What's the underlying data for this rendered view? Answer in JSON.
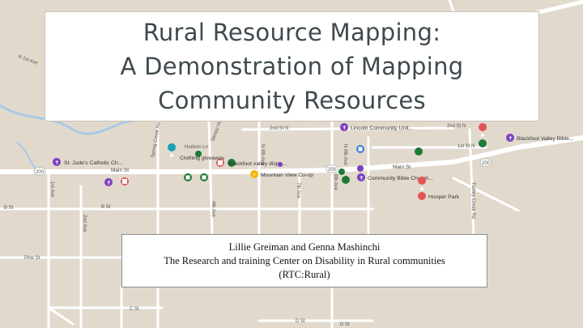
{
  "slide": {
    "title_lines": [
      "Rural Resource Mapping:",
      "A Demonstration of Mapping",
      "Community Resources"
    ],
    "authors": "Lillie Greiman and Genna Mashinchi",
    "organization": "The Research and training Center on Disability in Rural communities",
    "org_short": "(RTC:Rural)"
  },
  "map": {
    "streets": {
      "main_st_left": "Main St",
      "main_st_right": "Main St",
      "hudson_ln": "Hudson Ln",
      "second_st_n": "2nd St N",
      "second_st_n_right": "2nd St N",
      "first_st_n": "1st St N",
      "b_st": "B St",
      "b_st_2": "B St",
      "pine_st": "Pine St",
      "c_st": "C St",
      "d_st": "D St",
      "d_st_2": "D St",
      "first_ave_nw": "N 1st Ave",
      "first_ave": "1st Ave",
      "second_ave": "2nd Ave",
      "spring_creek": "Spring Creek Rd",
      "sleepy_hollow": "Sleepy Hollow Ln",
      "n_fourth_ave": "N 4th Ave",
      "n_eighth_ave": "N 8th Ave",
      "fourth_ave": "4th Ave",
      "seventh_ave": "7th Ave",
      "eighth_ave": "8th Ave",
      "turkey_creek": "Turkey Creek Rd",
      "hwy": "200"
    },
    "pois": {
      "st_judes": "St. Jude's Catholic Ch...",
      "clothing_giveaway": "Clothing giveaway",
      "blackfoot_dispatch": "Blackfoot valley dispa...",
      "mountain_view": "Mountain View Co-op",
      "lincoln_community": "Lincoln Community Unit...",
      "community_bible": "Community Bible Church...",
      "blackfoot_bible": "Blackfoot Valley Bible...",
      "hooper_park": "Hooper Park"
    },
    "colors": {
      "land": "#e2d9cd",
      "road": "#ffffff",
      "water": "#a9c9e6",
      "purple_pin": "#7b3fbf",
      "red_pin": "#e35355",
      "green_pin": "#1f7a3a",
      "teal_pin": "#1aa0b5",
      "yellow_pin": "#f4b400",
      "blue_pin": "#3d7bd6"
    }
  }
}
